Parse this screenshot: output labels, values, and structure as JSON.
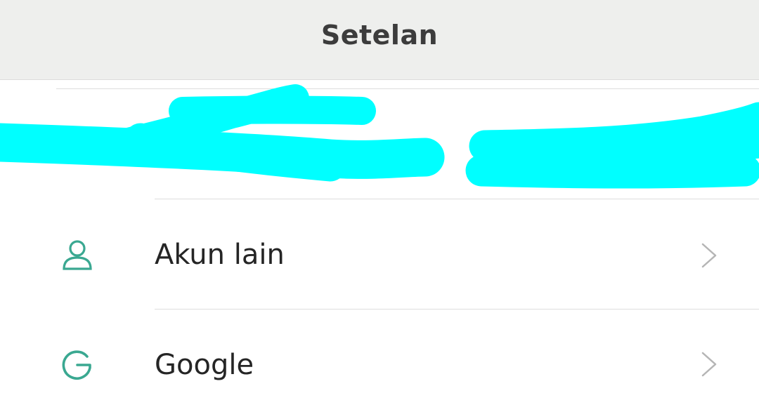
{
  "header": {
    "title": "Setelan"
  },
  "settings": {
    "items": [
      {
        "label": "Akun lain",
        "icon": "person-icon"
      },
      {
        "label": "Google",
        "icon": "google-icon"
      }
    ]
  },
  "colors": {
    "header_bg": "#eeefed",
    "accent": "#3aa891",
    "redaction": "#00ffff",
    "chevron": "#b5b5b5"
  }
}
